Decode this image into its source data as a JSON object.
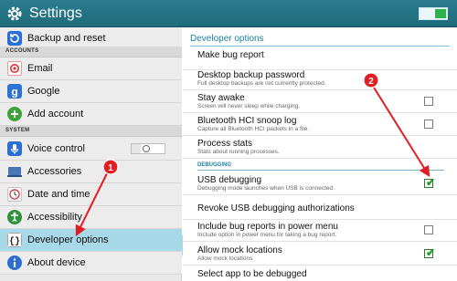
{
  "colors": {
    "actionbar": "#1f6b7b",
    "accent": "#1b7fa3",
    "active_item": "#a8d9e8",
    "annotation": "#e01e24",
    "check_green": "#1f9e2e"
  },
  "app": {
    "title": "Settings",
    "master_toggle": "on"
  },
  "sidebar": {
    "items_top": [
      {
        "label": "Backup and reset",
        "icon": "backup-reset-icon"
      }
    ],
    "section_accounts": "ACCOUNTS",
    "accounts": [
      {
        "label": "Email",
        "icon": "email-icon"
      },
      {
        "label": "Google",
        "icon": "google-icon"
      },
      {
        "label": "Add account",
        "icon": "add-account-icon"
      }
    ],
    "section_system": "SYSTEM",
    "system": [
      {
        "label": "Voice control",
        "icon": "microphone-icon",
        "toggle": "off"
      },
      {
        "label": "Accessories",
        "icon": "accessories-icon"
      },
      {
        "label": "Date and time",
        "icon": "clock-icon"
      },
      {
        "label": "Accessibility",
        "icon": "accessibility-icon"
      },
      {
        "label": "Developer options",
        "icon": "developer-options-icon",
        "active": true
      },
      {
        "label": "About device",
        "icon": "info-icon"
      }
    ]
  },
  "panel": {
    "title": "Developer options",
    "options": [
      {
        "title": "Make bug report",
        "sub": "",
        "checkbox": null
      },
      {
        "title": "Desktop backup password",
        "sub": "Full desktop backups are not currently protected.",
        "checkbox": null
      },
      {
        "title": "Stay awake",
        "sub": "Screen will never sleep while charging.",
        "checkbox": "unchecked"
      },
      {
        "title": "Bluetooth HCI snoop log",
        "sub": "Capture all Bluetooth HCI packets in a file.",
        "checkbox": "unchecked"
      },
      {
        "title": "Process stats",
        "sub": "Stats about running processes.",
        "checkbox": null
      }
    ],
    "section_debugging": "DEBUGGING",
    "debug_options": [
      {
        "title": "USB debugging",
        "sub": "Debugging mode launches when USB is connected.",
        "checkbox": "checked"
      },
      {
        "title": "Revoke USB debugging authorizations",
        "sub": "",
        "checkbox": null
      },
      {
        "title": "Include bug reports in power menu",
        "sub": "Include option in power menu for taking a bug report.",
        "checkbox": "unchecked"
      },
      {
        "title": "Allow mock locations",
        "sub": "Allow mock locations",
        "checkbox": "checked"
      },
      {
        "title": "Select app to be debugged",
        "sub": "",
        "checkbox": null
      }
    ]
  },
  "annotations": [
    {
      "label": "1"
    },
    {
      "label": "2"
    }
  ]
}
